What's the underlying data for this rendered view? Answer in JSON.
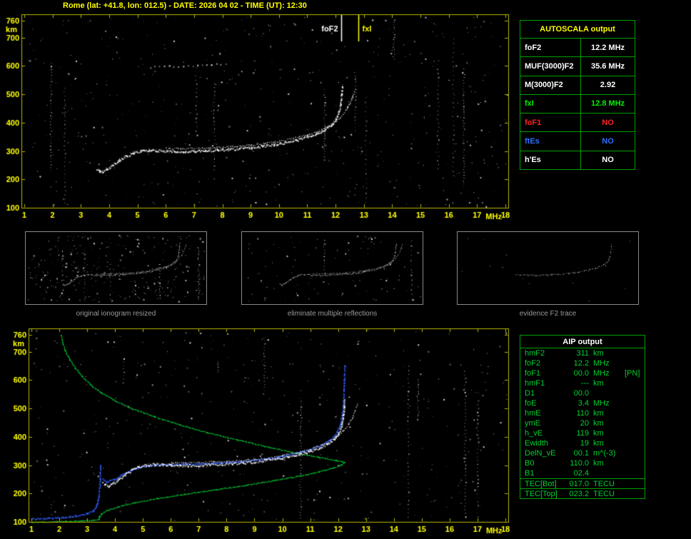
{
  "window": {
    "title": "Rome (lat: +41.8, lon: 012.5) - DATE: 2026 04 02 - TIME (UT): 12:30"
  },
  "colors": {
    "background": "#000000",
    "axis": "#b8b800",
    "axis_text": "#ffff00",
    "trace": "#ffffff",
    "profile_green": "#00cc33",
    "reconstructed_blue": "#2f5bff",
    "table_border": "#00a000",
    "autoscala_title": "#ffff00",
    "aip_text": "#00d030",
    "caption": "#9a9a9a"
  },
  "top_plot": {
    "x_ticks": [
      1,
      2,
      3,
      4,
      5,
      6,
      7,
      8,
      9,
      10,
      11,
      12,
      13,
      14,
      15,
      16,
      17,
      18
    ],
    "x_unit": "MHz",
    "y_ticks": [
      760,
      700,
      600,
      500,
      400,
      300,
      200,
      100
    ],
    "y_unit": "km",
    "x_range": [
      1,
      18
    ],
    "y_range": [
      100,
      782
    ],
    "markers": [
      {
        "label": "foF2",
        "mhz": 12.2,
        "color": "#ffffff"
      },
      {
        "label": "fxI",
        "mhz": 12.8,
        "color": "#ffff00"
      }
    ],
    "noise": {
      "seed": 1234,
      "count": 540,
      "streaks": 11
    }
  },
  "bottom_plot": {
    "x_ticks": [
      1,
      2,
      3,
      4,
      5,
      6,
      7,
      8,
      9,
      10,
      11,
      12,
      13,
      14,
      15,
      16,
      17,
      18
    ],
    "x_unit": "MHz",
    "y_ticks": [
      760,
      700,
      600,
      500,
      400,
      300,
      200,
      100
    ],
    "y_unit": "km",
    "x_range": [
      1,
      18
    ],
    "y_range": [
      100,
      782
    ],
    "markers": [],
    "noise": {
      "seed": 4321,
      "count": 430,
      "streaks": 8
    }
  },
  "thumbnails": [
    {
      "caption": "original ionogram resized",
      "x_range": [
        1,
        14
      ],
      "y_range": [
        100,
        600
      ],
      "noise": {
        "seed": 101,
        "count": 300,
        "streaks": 5
      },
      "show": [
        "omode",
        "xmode"
      ]
    },
    {
      "caption": "eliminate multiple reflections",
      "x_range": [
        1,
        14
      ],
      "y_range": [
        100,
        600
      ],
      "noise": {
        "seed": 202,
        "count": 110,
        "streaks": 2
      },
      "show": [
        "omode",
        "xmode"
      ]
    },
    {
      "caption": "evidence F2 trace",
      "x_range": [
        1,
        14
      ],
      "y_range": [
        100,
        600
      ],
      "noise": {
        "seed": 303,
        "count": 14,
        "streaks": 0
      },
      "show": [
        "f2_only"
      ]
    }
  ],
  "autoscala_table": {
    "title": "AUTOSCALA output",
    "rows": [
      {
        "label": "foF2",
        "value": "12.2 MHz",
        "color": "#ffffff"
      },
      {
        "label": "MUF(3000)F2",
        "value": "35.6 MHz",
        "color": "#ffffff"
      },
      {
        "label": "M(3000)F2",
        "value": "2.92",
        "color": "#ffffff"
      },
      {
        "label": "fxI",
        "value": "12.8 MHz",
        "color": "#00ee00"
      },
      {
        "label": "foF1",
        "value": "NO",
        "color": "#ff2222"
      },
      {
        "label": "ftEs",
        "value": "NO",
        "color": "#2b6fff"
      },
      {
        "label": "h'Es",
        "value": "NO",
        "color": "#ffffff"
      }
    ]
  },
  "aip_table": {
    "title": "AIP output",
    "rows": [
      {
        "label": "hmF2",
        "value": "311",
        "unit": "km",
        "extra": ""
      },
      {
        "label": "foF2",
        "value": "12.2",
        "unit": "MHz",
        "extra": ""
      },
      {
        "label": "foF1",
        "value": "00.0",
        "unit": "MHz",
        "extra": "[PN]"
      },
      {
        "label": "hmF1",
        "value": "---",
        "unit": "km",
        "extra": ""
      },
      {
        "label": "D1",
        "value": "00.0",
        "unit": "",
        "extra": ""
      },
      {
        "label": "foE",
        "value": "3.4",
        "unit": "MHz",
        "extra": ""
      },
      {
        "label": "hmE",
        "value": "110",
        "unit": "km",
        "extra": ""
      },
      {
        "label": "ymE",
        "value": "20",
        "unit": "km",
        "extra": ""
      },
      {
        "label": "h_vE",
        "value": "119",
        "unit": "km",
        "extra": ""
      },
      {
        "label": "Ewidth",
        "value": "19",
        "unit": "km",
        "extra": ""
      },
      {
        "label": "DelN_vE",
        "value": "00.1",
        "unit": "m^(-3)",
        "extra": ""
      },
      {
        "label": "B0",
        "value": "110.0",
        "unit": "km",
        "extra": ""
      },
      {
        "label": "B1",
        "value": "02.4",
        "unit": "",
        "extra": ""
      }
    ],
    "tec_rows": [
      {
        "label": "TEC[Bot]",
        "value": "017.0",
        "unit": "TECU"
      },
      {
        "label": "TEC[Top]",
        "value": "023.2",
        "unit": "TECU"
      }
    ]
  },
  "chart_data": {
    "type": "scatter",
    "x_axis": {
      "label": "MHz",
      "range": [
        1,
        18
      ],
      "ticks": [
        1,
        2,
        3,
        4,
        5,
        6,
        7,
        8,
        9,
        10,
        11,
        12,
        13,
        14,
        15,
        16,
        17,
        18
      ]
    },
    "y_axis": {
      "label": "km",
      "range": [
        100,
        782
      ],
      "ticks": [
        760,
        700,
        600,
        500,
        400,
        300,
        200,
        100
      ]
    },
    "key_values": {
      "foF2_MHz": 12.2,
      "fxI_MHz": 12.8,
      "hmF2_km": 311,
      "foE_MHz": 3.4,
      "hmE_km": 110
    },
    "traces": {
      "omode": [
        [
          3.55,
          237
        ],
        [
          3.65,
          230
        ],
        [
          3.75,
          229
        ],
        [
          3.9,
          236
        ],
        [
          4.1,
          250
        ],
        [
          4.35,
          268
        ],
        [
          4.6,
          284
        ],
        [
          4.85,
          295
        ],
        [
          5.1,
          301
        ],
        [
          5.4,
          304
        ],
        [
          5.7,
          303
        ],
        [
          6.0,
          301
        ],
        [
          6.3,
          300
        ],
        [
          6.6,
          300
        ],
        [
          7.0,
          301
        ],
        [
          7.4,
          303
        ],
        [
          7.8,
          305
        ],
        [
          8.2,
          307
        ],
        [
          8.6,
          310
        ],
        [
          9.0,
          313
        ],
        [
          9.4,
          318
        ],
        [
          9.8,
          324
        ],
        [
          10.2,
          331
        ],
        [
          10.6,
          340
        ],
        [
          11.0,
          351
        ],
        [
          11.3,
          362
        ],
        [
          11.6,
          376
        ],
        [
          11.85,
          393
        ],
        [
          12.0,
          412
        ],
        [
          12.1,
          437
        ],
        [
          12.16,
          468
        ],
        [
          12.2,
          505
        ],
        [
          12.22,
          528
        ]
      ],
      "xmode": [
        [
          6.0,
          311
        ],
        [
          6.5,
          310
        ],
        [
          7.0,
          311
        ],
        [
          7.5,
          313
        ],
        [
          8.0,
          315
        ],
        [
          8.5,
          318
        ],
        [
          9.0,
          322
        ],
        [
          9.5,
          328
        ],
        [
          10.0,
          336
        ],
        [
          10.5,
          346
        ],
        [
          11.0,
          359
        ],
        [
          11.5,
          376
        ],
        [
          11.9,
          398
        ],
        [
          12.15,
          420
        ],
        [
          12.35,
          445
        ],
        [
          12.5,
          470
        ],
        [
          12.6,
          495
        ],
        [
          12.68,
          520
        ]
      ],
      "second_hop": [
        [
          5.6,
          598
        ],
        [
          6.1,
          601
        ],
        [
          6.6,
          600
        ],
        [
          7.1,
          603
        ],
        [
          7.6,
          606
        ],
        [
          8.1,
          610
        ]
      ],
      "profile": [
        [
          2.05,
          760
        ],
        [
          2.1,
          735
        ],
        [
          2.2,
          705
        ],
        [
          2.35,
          675
        ],
        [
          2.55,
          645
        ],
        [
          2.8,
          615
        ],
        [
          3.1,
          585
        ],
        [
          3.5,
          556
        ],
        [
          4.0,
          528
        ],
        [
          4.6,
          500
        ],
        [
          5.4,
          472
        ],
        [
          6.3,
          444
        ],
        [
          7.3,
          416
        ],
        [
          8.4,
          390
        ],
        [
          9.5,
          365
        ],
        [
          10.5,
          344
        ],
        [
          11.3,
          329
        ],
        [
          11.9,
          318
        ],
        [
          12.15,
          313
        ],
        [
          12.2,
          311
        ],
        [
          12.1,
          302
        ],
        [
          11.8,
          291
        ],
        [
          11.3,
          278
        ],
        [
          10.6,
          263
        ],
        [
          9.7,
          247
        ],
        [
          8.7,
          231
        ],
        [
          7.6,
          215
        ],
        [
          6.5,
          199
        ],
        [
          5.5,
          184
        ],
        [
          4.7,
          169
        ],
        [
          4.1,
          155
        ],
        [
          3.7,
          142
        ],
        [
          3.5,
          130
        ],
        [
          3.44,
          121
        ],
        [
          3.42,
          119
        ],
        [
          3.4,
          110
        ],
        [
          3.2,
          107
        ],
        [
          2.8,
          105
        ],
        [
          2.2,
          103
        ],
        [
          1.4,
          101
        ],
        [
          1.0,
          100
        ]
      ],
      "blue_e": [
        [
          1.0,
          112
        ],
        [
          1.6,
          114
        ],
        [
          2.1,
          117
        ],
        [
          2.6,
          123
        ],
        [
          3.0,
          131
        ],
        [
          3.2,
          141
        ],
        [
          3.32,
          158
        ],
        [
          3.4,
          190
        ],
        [
          3.44,
          235
        ],
        [
          3.46,
          295
        ],
        [
          3.47,
          302
        ]
      ],
      "blue_f": [
        [
          3.55,
          252
        ],
        [
          3.7,
          242
        ],
        [
          3.95,
          252
        ],
        [
          4.2,
          266
        ],
        [
          4.5,
          280
        ],
        [
          4.8,
          292
        ],
        [
          5.1,
          299
        ],
        [
          5.5,
          302
        ],
        [
          6.0,
          303
        ],
        [
          6.5,
          304
        ],
        [
          7.0,
          306
        ],
        [
          7.5,
          308
        ],
        [
          8.0,
          311
        ],
        [
          8.5,
          314
        ],
        [
          9.0,
          319
        ],
        [
          9.5,
          325
        ],
        [
          10.0,
          333
        ],
        [
          10.5,
          344
        ],
        [
          11.0,
          358
        ],
        [
          11.4,
          373
        ],
        [
          11.7,
          391
        ],
        [
          11.9,
          412
        ],
        [
          12.05,
          440
        ],
        [
          12.13,
          478
        ],
        [
          12.18,
          525
        ],
        [
          12.2,
          572
        ],
        [
          12.21,
          605
        ],
        [
          12.22,
          655
        ]
      ]
    }
  }
}
